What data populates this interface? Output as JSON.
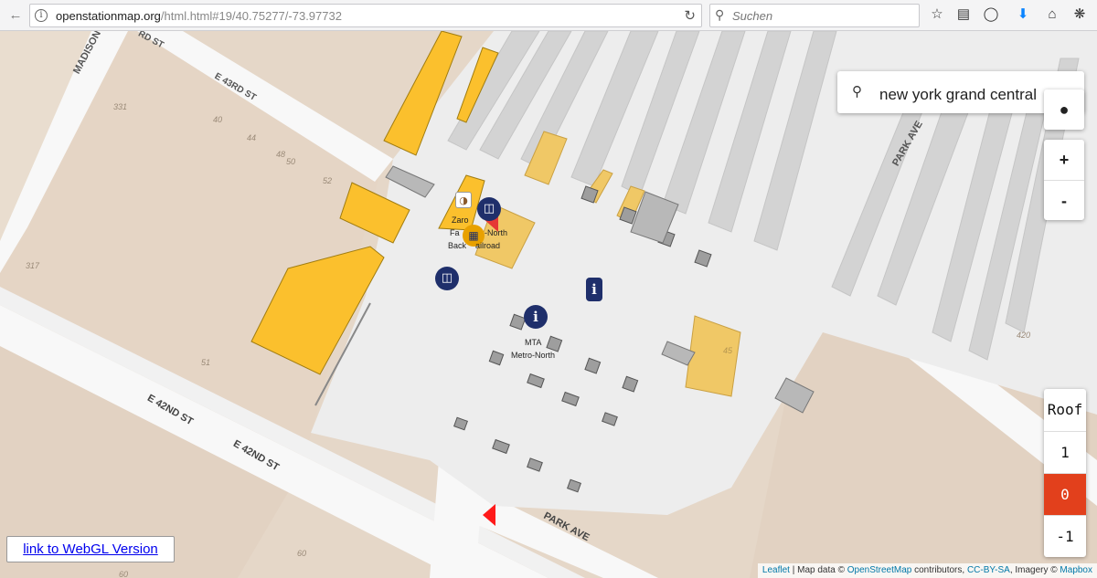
{
  "browser": {
    "url_host": "openstationmap.org",
    "url_path": "/html.html#19/40.75277/-73.97732",
    "search_placeholder": "Suchen"
  },
  "map": {
    "search_query": "new york grand central",
    "zoom_in": "+",
    "zoom_out": "-",
    "levels": [
      "Roof",
      "1",
      "0",
      "-1"
    ],
    "active_level": "0",
    "webgl_link": "link to WebGL Version",
    "streets": {
      "madison": "MADISON",
      "e43_top": "RD ST",
      "e43": "E 43RD ST",
      "e42_a": "E 42ND ST",
      "e42_b": "E 42ND ST",
      "park_ave_top": "PARK AVE",
      "park_ave_bottom": "PARK AVE"
    },
    "house_numbers": [
      "331",
      "40",
      "44",
      "48",
      "50",
      "52",
      "317",
      "51",
      "60",
      "60",
      "420",
      "45"
    ],
    "poi_labels": {
      "zaro_a": "Zaro",
      "zaro_b": "Fa",
      "zaro_c": "Back",
      "metro_a": "-North",
      "metro_b": "ailroad",
      "mta_a": "MTA",
      "mta_b": "Metro-North"
    },
    "info_icon_char": "i",
    "attribution": {
      "leaflet": "Leaflet",
      "map_data": " | Map data © ",
      "osm": "OpenStreetMap",
      "contrib": " contributors, ",
      "license": "CC-BY-SA",
      "imagery": ", Imagery © ",
      "mapbox": "Mapbox"
    },
    "colors": {
      "active_level": "#e2401c",
      "building_yellow": "#fbc02d",
      "poi_navy": "#1f2f6b",
      "platform_gray": "#d3d3d3",
      "land": "#e5d7c8"
    }
  }
}
